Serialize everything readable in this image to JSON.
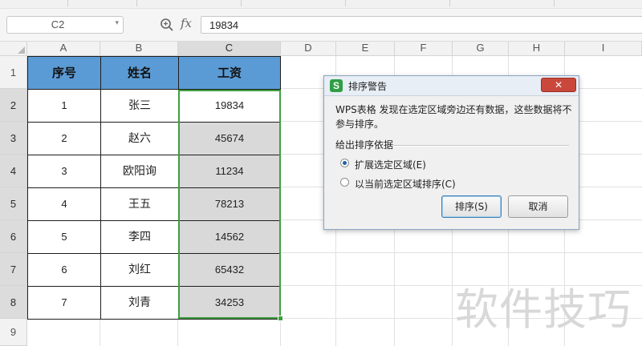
{
  "formula_bar": {
    "cell_ref": "C2",
    "fx_label": "fx",
    "value": "19834"
  },
  "sheet": {
    "columns": [
      "A",
      "B",
      "C",
      "D",
      "E",
      "F",
      "G",
      "H",
      "I"
    ],
    "rows": [
      "1",
      "2",
      "3",
      "4",
      "5",
      "6",
      "7",
      "8",
      "9"
    ],
    "selected_column": "C",
    "selected_cell": "C2",
    "table": {
      "headers": [
        "序号",
        "姓名",
        "工资"
      ],
      "rows": [
        [
          "1",
          "张三",
          "19834"
        ],
        [
          "2",
          "赵六",
          "45674"
        ],
        [
          "3",
          "欧阳询",
          "11234"
        ],
        [
          "4",
          "王五",
          "78213"
        ],
        [
          "5",
          "李四",
          "14562"
        ],
        [
          "6",
          "刘红",
          "65432"
        ],
        [
          "7",
          "刘青",
          "34253"
        ]
      ]
    },
    "header_fill": "#5b9bd5",
    "selection_color": "#3f9f3f"
  },
  "dialog": {
    "app_icon": "S",
    "title": "排序警告",
    "close_glyph": "✕",
    "message": "WPS表格 发现在选定区域旁边还有数据，这些数据将不参与排序。",
    "group_label": "给出排序依据",
    "options": [
      {
        "label": "扩展选定区域(E)",
        "checked": true
      },
      {
        "label": "以当前选定区域排序(C)",
        "checked": false
      }
    ],
    "sort_button": "排序(S)",
    "cancel_button": "取消"
  },
  "watermark": "软件技巧"
}
